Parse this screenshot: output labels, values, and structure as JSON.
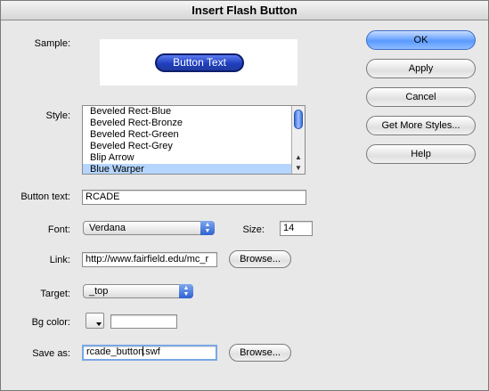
{
  "window": {
    "title": "Insert Flash Button"
  },
  "sample": {
    "label": "Sample:",
    "button_text": "Button Text"
  },
  "style": {
    "label": "Style:",
    "items": [
      "Beveled Rect-Blue",
      "Beveled Rect-Bronze",
      "Beveled Rect-Green",
      "Beveled Rect-Grey",
      "Blip Arrow",
      "Blue Warper"
    ],
    "selected": "Blue Warper"
  },
  "button_text": {
    "label": "Button text:",
    "value": "RCADE"
  },
  "font": {
    "label": "Font:",
    "value": "Verdana"
  },
  "size": {
    "label": "Size:",
    "value": "14"
  },
  "link": {
    "label": "Link:",
    "value": "http://www.fairfield.edu/mc_r",
    "browse_label": "Browse..."
  },
  "target": {
    "label": "Target:",
    "value": "_top"
  },
  "bg_color": {
    "label": "Bg color:",
    "value": ""
  },
  "save_as": {
    "label": "Save as:",
    "value_before_caret": "rcade_button",
    "value_after_caret": ".swf",
    "browse_label": "Browse..."
  },
  "actions": {
    "ok": "OK",
    "apply": "Apply",
    "cancel": "Cancel",
    "get_more_styles": "Get More Styles...",
    "help": "Help"
  },
  "colors": {
    "accent": "#5a9aff",
    "selection": "#b5d5ff",
    "sample_button": "#1f3fbf"
  }
}
